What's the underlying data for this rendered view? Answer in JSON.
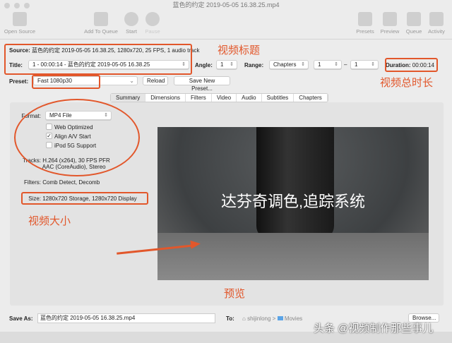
{
  "window": {
    "title": "蓝色的约定 2019-05-05 16.38.25.mp4"
  },
  "toolbar": {
    "open_source": "Open Source",
    "add_to_queue": "Add To Queue",
    "start": "Start",
    "pause": "Pause",
    "presets": "Presets",
    "preview": "Preview",
    "queue": "Queue",
    "activity": "Activity"
  },
  "source": {
    "label": "Source:",
    "value": "蓝色的约定 2019-05-05 16.38.25, 1280x720, 25 FPS, 1 audio track"
  },
  "title_row": {
    "label": "Title:",
    "value": "1 - 00:00:14 - 蓝色的约定 2019-05-05 16.38.25",
    "angle_label": "Angle:",
    "angle": "1",
    "range_label": "Range:",
    "range": "Chapters",
    "from": "1",
    "dash": "–",
    "to": "1",
    "duration_label": "Duration:",
    "duration": "00:00:14"
  },
  "preset": {
    "label": "Preset:",
    "value": "Fast 1080p30",
    "reload": "Reload",
    "save_new": "Save New Preset..."
  },
  "tabs": [
    "Summary",
    "Dimensions",
    "Filters",
    "Video",
    "Audio",
    "Subtitles",
    "Chapters"
  ],
  "summary": {
    "format_label": "Format:",
    "format": "MP4 File",
    "web_optimized": "Web Optimized",
    "align_av": "Align A/V Start",
    "ipod": "iPod 5G Support",
    "checks": {
      "web_optimized": false,
      "align_av": true,
      "ipod": false
    },
    "tracks_label": "Tracks:",
    "tracks1": "H.264 (x264), 30 FPS PFR",
    "tracks2": "AAC (CoreAudio), Stereo",
    "filters_label": "Filters:",
    "filters": "Comb Detect, Decomb",
    "size_label": "Size:",
    "size": "1280x720 Storage, 1280x720 Display"
  },
  "preview": {
    "overlay_text": "达芬奇调色,追踪系统"
  },
  "save": {
    "label": "Save As:",
    "value": "蓝色的约定 2019-05-05 16.38.25.mp4",
    "to_label": "To:",
    "path_user": "shijinlong",
    "path_sep": ">",
    "path_folder": "Movies",
    "browse": "Browse..."
  },
  "annotations": {
    "title": "视频标题",
    "duration": "视频总时长",
    "size": "视频大小",
    "preview": "预览",
    "color": "#e2572b"
  },
  "watermark": "头条 @视频制作那些事儿"
}
